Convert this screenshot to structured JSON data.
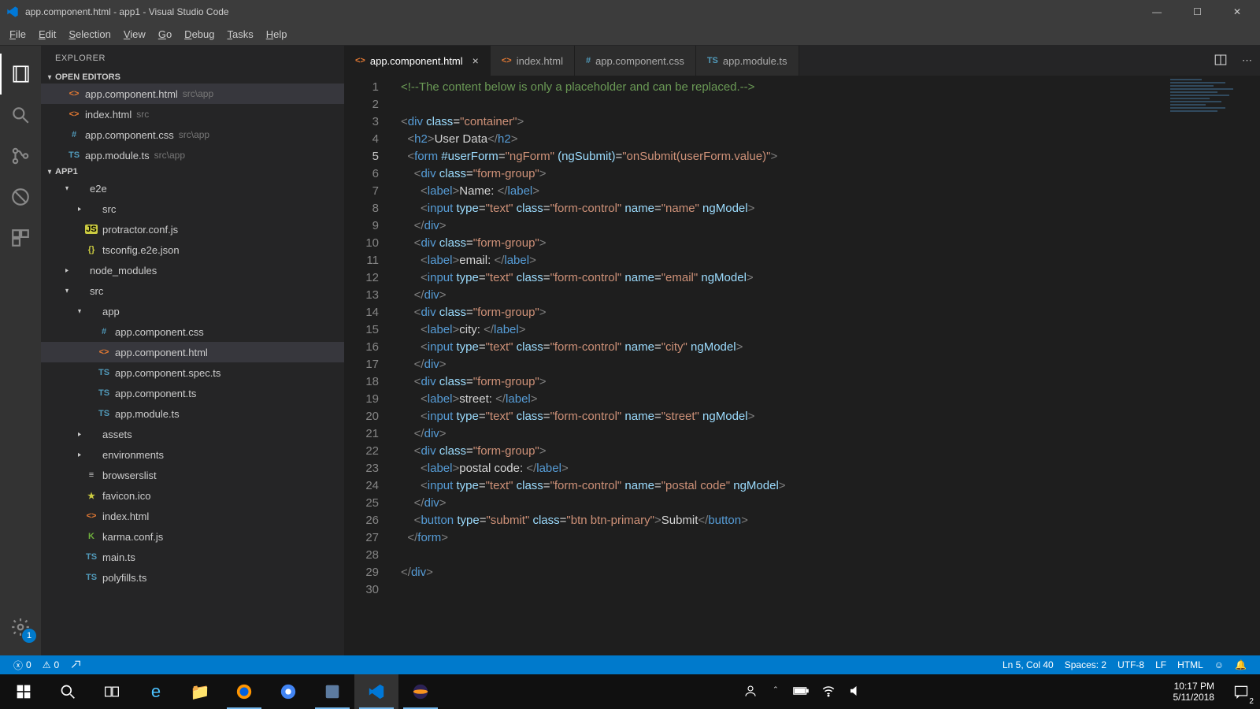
{
  "window": {
    "title": "app.component.html - app1 - Visual Studio Code"
  },
  "menubar": [
    "File",
    "Edit",
    "Selection",
    "View",
    "Go",
    "Debug",
    "Tasks",
    "Help"
  ],
  "activity_bar": {
    "badge": "1"
  },
  "sidebar": {
    "title": "EXPLORER",
    "sections": {
      "open_editors": {
        "label": "OPEN EDITORS",
        "items": [
          {
            "icon": "<>",
            "iconClass": "fc-html",
            "name": "app.component.html",
            "meta": "src\\app",
            "selected": true
          },
          {
            "icon": "<>",
            "iconClass": "fc-html",
            "name": "index.html",
            "meta": "src"
          },
          {
            "icon": "#",
            "iconClass": "fc-css",
            "name": "app.component.css",
            "meta": "src\\app"
          },
          {
            "icon": "TS",
            "iconClass": "fc-ts",
            "name": "app.module.ts",
            "meta": "src\\app"
          }
        ]
      },
      "project": {
        "label": "APP1",
        "tree": [
          {
            "indent": 1,
            "chev": "▾",
            "icon": "",
            "iconClass": "fc-folder",
            "name": "e2e"
          },
          {
            "indent": 2,
            "chev": "▸",
            "icon": "",
            "iconClass": "fc-folder",
            "name": "src"
          },
          {
            "indent": 2,
            "chev": "",
            "icon": "JS",
            "iconClass": "fc-js",
            "name": "protractor.conf.js"
          },
          {
            "indent": 2,
            "chev": "",
            "icon": "{}",
            "iconClass": "fc-json",
            "name": "tsconfig.e2e.json"
          },
          {
            "indent": 1,
            "chev": "▸",
            "icon": "",
            "iconClass": "fc-folder",
            "name": "node_modules"
          },
          {
            "indent": 1,
            "chev": "▾",
            "icon": "",
            "iconClass": "fc-folder",
            "name": "src"
          },
          {
            "indent": 2,
            "chev": "▾",
            "icon": "",
            "iconClass": "fc-folder",
            "name": "app"
          },
          {
            "indent": 3,
            "chev": "",
            "icon": "#",
            "iconClass": "fc-css",
            "name": "app.component.css"
          },
          {
            "indent": 3,
            "chev": "",
            "icon": "<>",
            "iconClass": "fc-html",
            "name": "app.component.html",
            "selected": true
          },
          {
            "indent": 3,
            "chev": "",
            "icon": "TS",
            "iconClass": "fc-ts",
            "name": "app.component.spec.ts"
          },
          {
            "indent": 3,
            "chev": "",
            "icon": "TS",
            "iconClass": "fc-ts",
            "name": "app.component.ts"
          },
          {
            "indent": 3,
            "chev": "",
            "icon": "TS",
            "iconClass": "fc-ts",
            "name": "app.module.ts"
          },
          {
            "indent": 2,
            "chev": "▸",
            "icon": "",
            "iconClass": "fc-folder",
            "name": "assets"
          },
          {
            "indent": 2,
            "chev": "▸",
            "icon": "",
            "iconClass": "fc-folder",
            "name": "environments"
          },
          {
            "indent": 2,
            "chev": "",
            "icon": "≡",
            "iconClass": "fc-folder",
            "name": "browserslist"
          },
          {
            "indent": 2,
            "chev": "",
            "icon": "★",
            "iconClass": "fc-ico",
            "name": "favicon.ico"
          },
          {
            "indent": 2,
            "chev": "",
            "icon": "<>",
            "iconClass": "fc-html",
            "name": "index.html"
          },
          {
            "indent": 2,
            "chev": "",
            "icon": "K",
            "iconClass": "fc-k",
            "name": "karma.conf.js"
          },
          {
            "indent": 2,
            "chev": "",
            "icon": "TS",
            "iconClass": "fc-ts",
            "name": "main.ts"
          },
          {
            "indent": 2,
            "chev": "",
            "icon": "TS",
            "iconClass": "fc-ts",
            "name": "polyfills.ts"
          }
        ]
      }
    }
  },
  "tabs": [
    {
      "icon": "<>",
      "iconClass": "fc-html",
      "label": "app.component.html",
      "active": true,
      "close": true
    },
    {
      "icon": "<>",
      "iconClass": "fc-html",
      "label": "index.html"
    },
    {
      "icon": "#",
      "iconClass": "fc-css",
      "label": "app.component.css"
    },
    {
      "icon": "TS",
      "iconClass": "fc-ts",
      "label": "app.module.ts"
    }
  ],
  "editor": {
    "lines": [
      {
        "n": 1,
        "html": "<span class='tk-comment'>&lt;!--The content below is only a placeholder and can be replaced.--&gt;</span>"
      },
      {
        "n": 2,
        "html": ""
      },
      {
        "n": 3,
        "html": "<span class='tk-br'>&lt;</span><span class='tk-tag'>div</span> <span class='tk-attr'>class</span>=<span class='tk-str'>\"container\"</span><span class='tk-br'>&gt;</span>"
      },
      {
        "n": 4,
        "html": "  <span class='tk-br'>&lt;</span><span class='tk-tag'>h2</span><span class='tk-br'>&gt;</span>User Data<span class='tk-br'>&lt;/</span><span class='tk-tag'>h2</span><span class='tk-br'>&gt;</span>"
      },
      {
        "n": 5,
        "html": "  <span class='tk-br'>&lt;</span><span class='tk-tag'>form</span> <span class='tk-attr'>#userForm</span>=<span class='tk-str'>\"ngForm\"</span> <span class='tk-attr'>(ngSubmit)</span>=<span class='tk-str'>\"onSubmit(userForm.value)\"</span><span class='tk-br'>&gt;</span>",
        "active": true
      },
      {
        "n": 6,
        "html": "    <span class='tk-br'>&lt;</span><span class='tk-tag'>div</span> <span class='tk-attr'>class</span>=<span class='tk-str'>\"form-group\"</span><span class='tk-br'>&gt;</span>"
      },
      {
        "n": 7,
        "html": "      <span class='tk-br'>&lt;</span><span class='tk-tag'>label</span><span class='tk-br'>&gt;</span>Name: <span class='tk-br'>&lt;/</span><span class='tk-tag'>label</span><span class='tk-br'>&gt;</span>"
      },
      {
        "n": 8,
        "html": "      <span class='tk-br'>&lt;</span><span class='tk-tag'>input</span> <span class='tk-attr'>type</span>=<span class='tk-str'>\"text\"</span> <span class='tk-attr'>class</span>=<span class='tk-str'>\"form-control\"</span> <span class='tk-attr'>name</span>=<span class='tk-str'>\"name\"</span> <span class='tk-attr'>ngModel</span><span class='tk-br'>&gt;</span>"
      },
      {
        "n": 9,
        "html": "    <span class='tk-br'>&lt;/</span><span class='tk-tag'>div</span><span class='tk-br'>&gt;</span>"
      },
      {
        "n": 10,
        "html": "    <span class='tk-br'>&lt;</span><span class='tk-tag'>div</span> <span class='tk-attr'>class</span>=<span class='tk-str'>\"form-group\"</span><span class='tk-br'>&gt;</span>"
      },
      {
        "n": 11,
        "html": "      <span class='tk-br'>&lt;</span><span class='tk-tag'>label</span><span class='tk-br'>&gt;</span>email: <span class='tk-br'>&lt;/</span><span class='tk-tag'>label</span><span class='tk-br'>&gt;</span>"
      },
      {
        "n": 12,
        "html": "      <span class='tk-br'>&lt;</span><span class='tk-tag'>input</span> <span class='tk-attr'>type</span>=<span class='tk-str'>\"text\"</span> <span class='tk-attr'>class</span>=<span class='tk-str'>\"form-control\"</span> <span class='tk-attr'>name</span>=<span class='tk-str'>\"email\"</span> <span class='tk-attr'>ngModel</span><span class='tk-br'>&gt;</span>"
      },
      {
        "n": 13,
        "html": "    <span class='tk-br'>&lt;/</span><span class='tk-tag'>div</span><span class='tk-br'>&gt;</span>"
      },
      {
        "n": 14,
        "html": "    <span class='tk-br'>&lt;</span><span class='tk-tag'>div</span> <span class='tk-attr'>class</span>=<span class='tk-str'>\"form-group\"</span><span class='tk-br'>&gt;</span>"
      },
      {
        "n": 15,
        "html": "      <span class='tk-br'>&lt;</span><span class='tk-tag'>label</span><span class='tk-br'>&gt;</span>city: <span class='tk-br'>&lt;/</span><span class='tk-tag'>label</span><span class='tk-br'>&gt;</span>"
      },
      {
        "n": 16,
        "html": "      <span class='tk-br'>&lt;</span><span class='tk-tag'>input</span> <span class='tk-attr'>type</span>=<span class='tk-str'>\"text\"</span> <span class='tk-attr'>class</span>=<span class='tk-str'>\"form-control\"</span> <span class='tk-attr'>name</span>=<span class='tk-str'>\"city\"</span> <span class='tk-attr'>ngModel</span><span class='tk-br'>&gt;</span>"
      },
      {
        "n": 17,
        "html": "    <span class='tk-br'>&lt;/</span><span class='tk-tag'>div</span><span class='tk-br'>&gt;</span>"
      },
      {
        "n": 18,
        "html": "    <span class='tk-br'>&lt;</span><span class='tk-tag'>div</span> <span class='tk-attr'>class</span>=<span class='tk-str'>\"form-group\"</span><span class='tk-br'>&gt;</span>"
      },
      {
        "n": 19,
        "html": "      <span class='tk-br'>&lt;</span><span class='tk-tag'>label</span><span class='tk-br'>&gt;</span>street: <span class='tk-br'>&lt;/</span><span class='tk-tag'>label</span><span class='tk-br'>&gt;</span>"
      },
      {
        "n": 20,
        "html": "      <span class='tk-br'>&lt;</span><span class='tk-tag'>input</span> <span class='tk-attr'>type</span>=<span class='tk-str'>\"text\"</span> <span class='tk-attr'>class</span>=<span class='tk-str'>\"form-control\"</span> <span class='tk-attr'>name</span>=<span class='tk-str'>\"street\"</span> <span class='tk-attr'>ngModel</span><span class='tk-br'>&gt;</span>"
      },
      {
        "n": 21,
        "html": "    <span class='tk-br'>&lt;/</span><span class='tk-tag'>div</span><span class='tk-br'>&gt;</span>"
      },
      {
        "n": 22,
        "html": "    <span class='tk-br'>&lt;</span><span class='tk-tag'>div</span> <span class='tk-attr'>class</span>=<span class='tk-str'>\"form-group\"</span><span class='tk-br'>&gt;</span>"
      },
      {
        "n": 23,
        "html": "      <span class='tk-br'>&lt;</span><span class='tk-tag'>label</span><span class='tk-br'>&gt;</span>postal code: <span class='tk-br'>&lt;/</span><span class='tk-tag'>label</span><span class='tk-br'>&gt;</span>"
      },
      {
        "n": 24,
        "html": "      <span class='tk-br'>&lt;</span><span class='tk-tag'>input</span> <span class='tk-attr'>type</span>=<span class='tk-str'>\"text\"</span> <span class='tk-attr'>class</span>=<span class='tk-str'>\"form-control\"</span> <span class='tk-attr'>name</span>=<span class='tk-str'>\"postal code\"</span> <span class='tk-attr'>ngModel</span><span class='tk-br'>&gt;</span>"
      },
      {
        "n": 25,
        "html": "    <span class='tk-br'>&lt;/</span><span class='tk-tag'>div</span><span class='tk-br'>&gt;</span>"
      },
      {
        "n": 26,
        "html": "    <span class='tk-br'>&lt;</span><span class='tk-tag'>button</span> <span class='tk-attr'>type</span>=<span class='tk-str'>\"submit\"</span> <span class='tk-attr'>class</span>=<span class='tk-str'>\"btn btn-primary\"</span><span class='tk-br'>&gt;</span>Submit<span class='tk-br'>&lt;/</span><span class='tk-tag'>button</span><span class='tk-br'>&gt;</span>"
      },
      {
        "n": 27,
        "html": "  <span class='tk-br'>&lt;/</span><span class='tk-tag'>form</span><span class='tk-br'>&gt;</span>"
      },
      {
        "n": 28,
        "html": ""
      },
      {
        "n": 29,
        "html": "<span class='tk-br'>&lt;/</span><span class='tk-tag'>div</span><span class='tk-br'>&gt;</span>"
      },
      {
        "n": 30,
        "html": ""
      }
    ]
  },
  "statusbar": {
    "errors": "0",
    "warnings": "0",
    "cursor": "Ln 5, Col 40",
    "spaces": "Spaces: 2",
    "encoding": "UTF-8",
    "eol": "LF",
    "lang": "HTML"
  },
  "taskbar": {
    "time": "10:17 PM",
    "date": "5/11/2018",
    "notif": "2"
  }
}
